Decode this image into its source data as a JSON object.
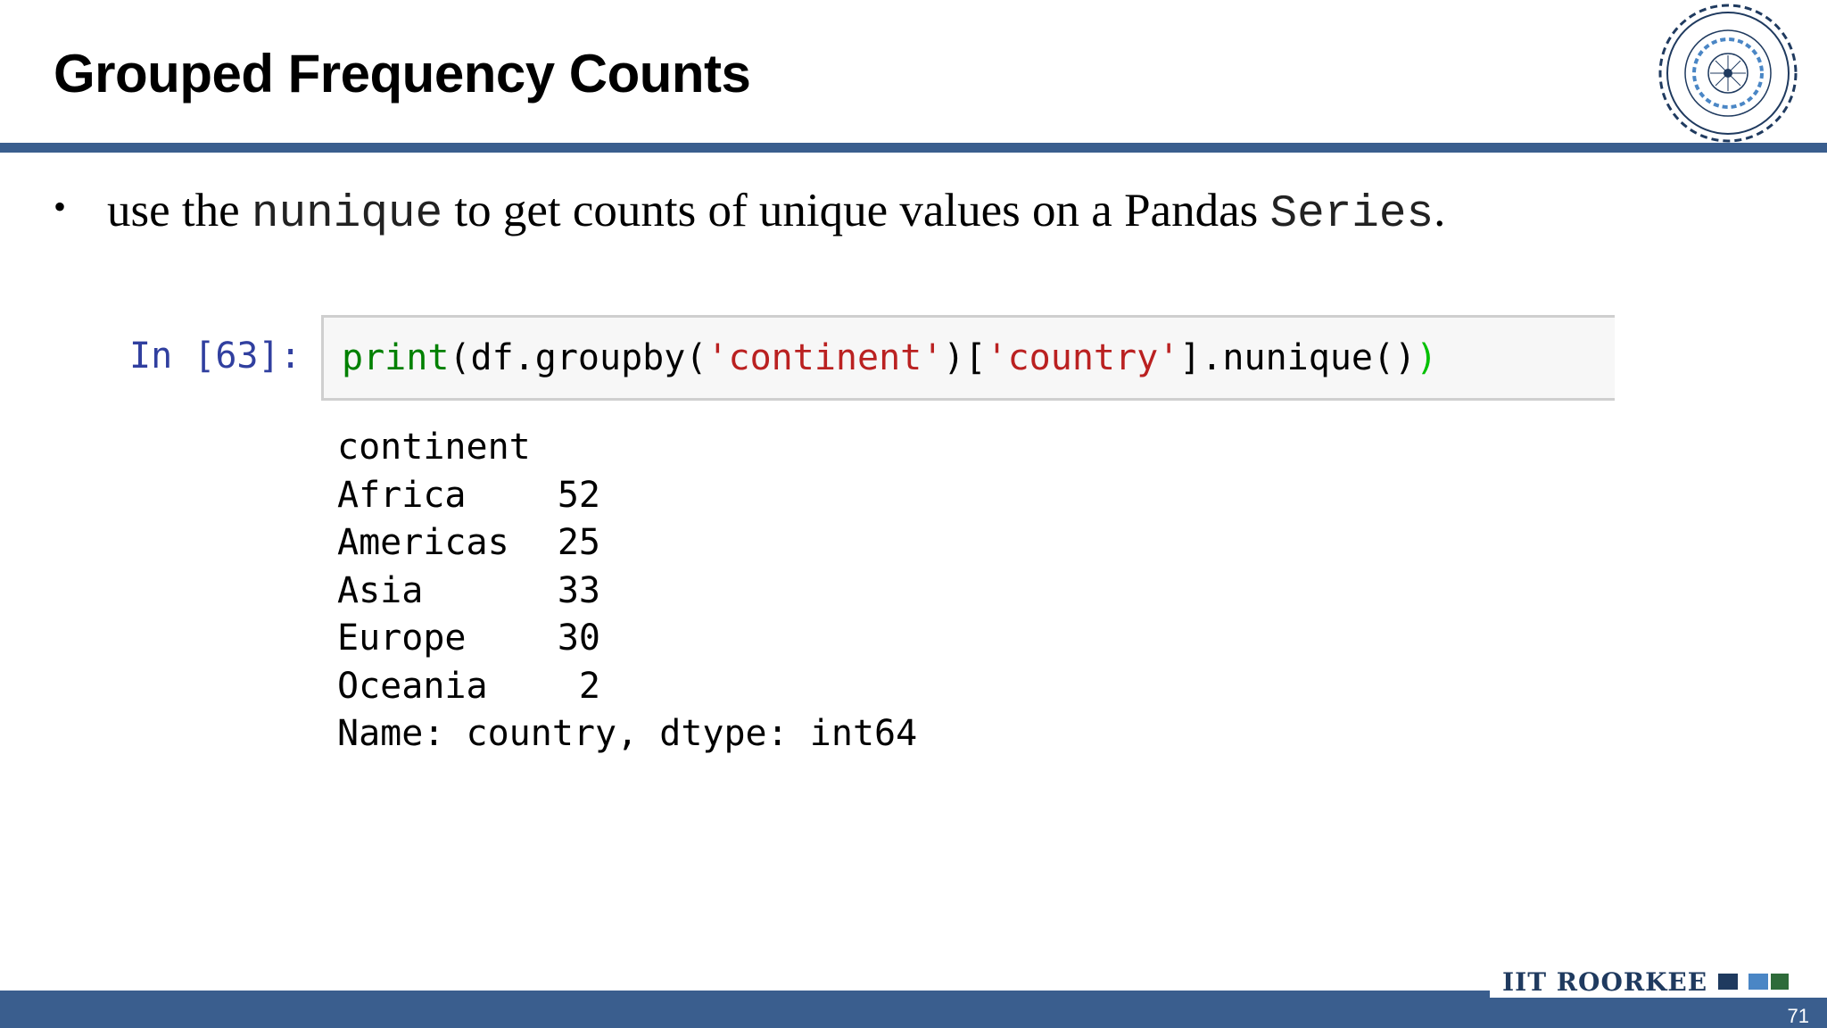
{
  "slide": {
    "title": "Grouped Frequency Counts",
    "page_number": "71"
  },
  "bullet": {
    "part1": "use the ",
    "code1": "nunique",
    "part2": " to get counts of unique values on a Pandas ",
    "code2": "Series",
    "part3": "."
  },
  "cell": {
    "prompt": "In [63]:",
    "code": {
      "t1": "print",
      "t2": "(",
      "t3": "df.groupby(",
      "t4": "'continent'",
      "t5": ")[",
      "t6": "'country'",
      "t7": "].nunique()",
      "t8": ")"
    },
    "output": {
      "header": "continent",
      "rows": [
        {
          "name": "Africa",
          "value": "52"
        },
        {
          "name": "Americas",
          "value": "25"
        },
        {
          "name": "Asia",
          "value": "33"
        },
        {
          "name": "Europe",
          "value": "30"
        },
        {
          "name": "Oceania",
          "value": "2"
        }
      ],
      "footer": "Name: country, dtype: int64"
    }
  },
  "footer": {
    "brand": "IIT ROORKEE"
  },
  "colors": {
    "accent": "#3a5e8e",
    "prompt": "#303f9f",
    "string": "#ba2121",
    "builtin": "#008000"
  }
}
